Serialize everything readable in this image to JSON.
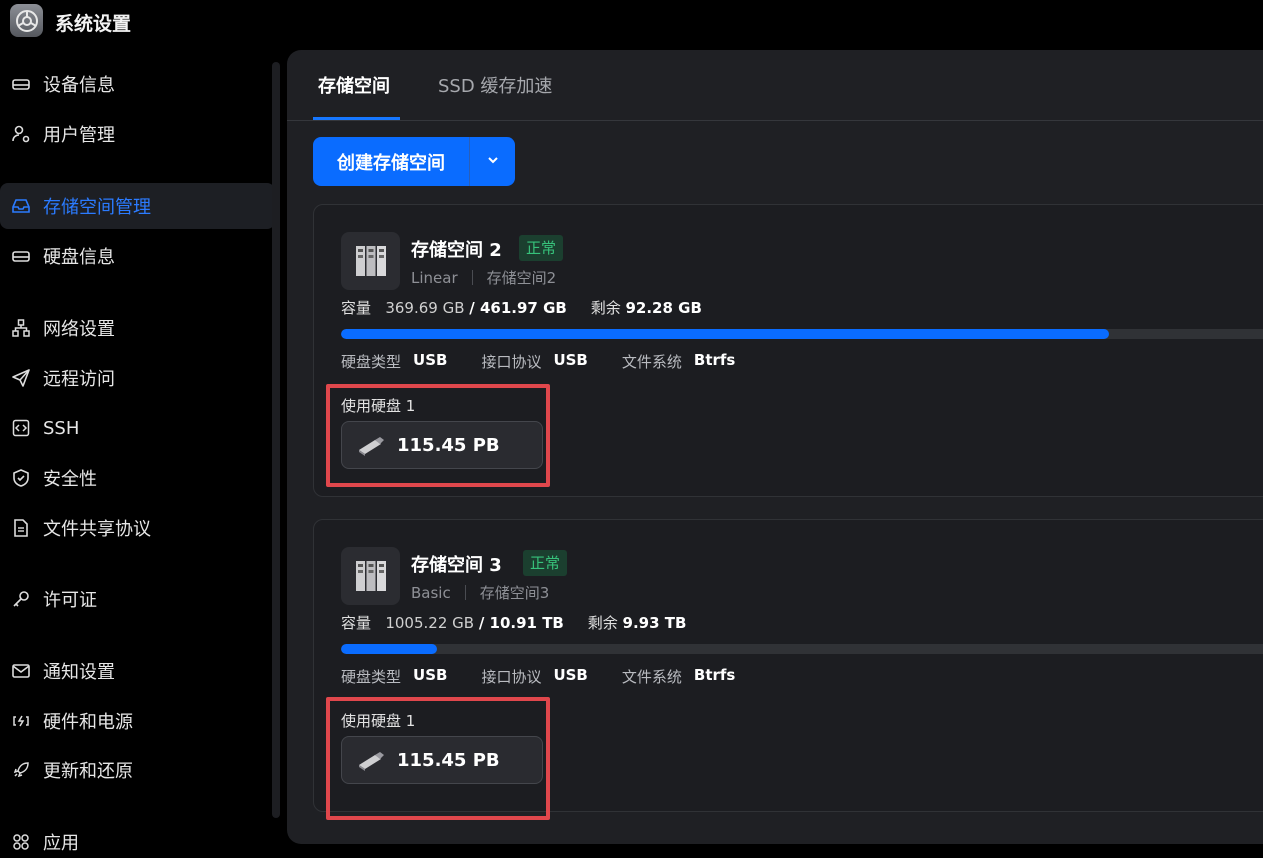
{
  "app": {
    "title": "系统设置"
  },
  "sidebar": {
    "items": [
      {
        "label": "设备信息",
        "icon": "drive-icon"
      },
      {
        "label": "用户管理",
        "icon": "user-gear-icon"
      },
      {
        "label": "存储空间管理",
        "icon": "inbox-icon",
        "active": true
      },
      {
        "label": "硬盘信息",
        "icon": "drive-icon"
      },
      {
        "label": "网络设置",
        "icon": "network-icon"
      },
      {
        "label": "远程访问",
        "icon": "paper-plane-icon"
      },
      {
        "label": "SSH",
        "icon": "code-icon"
      },
      {
        "label": "安全性",
        "icon": "shield-icon"
      },
      {
        "label": "文件共享协议",
        "icon": "document-icon"
      },
      {
        "label": "许可证",
        "icon": "key-icon"
      },
      {
        "label": "通知设置",
        "icon": "mail-icon"
      },
      {
        "label": "硬件和电源",
        "icon": "battery-icon"
      },
      {
        "label": "更新和还原",
        "icon": "rocket-icon"
      },
      {
        "label": "应用",
        "icon": "apps-grid-icon"
      }
    ]
  },
  "tabs": [
    {
      "label": "存储空间",
      "active": true
    },
    {
      "label": "SSD 缓存加速",
      "active": false
    }
  ],
  "toolbar": {
    "create_label": "创建存储空间"
  },
  "labels": {
    "capacity": "容量",
    "remaining": "剩余",
    "disk_type": "硬盘类型",
    "interface": "接口协议",
    "filesystem": "文件系统"
  },
  "pools": [
    {
      "name": "存储空间 2",
      "status": "正常",
      "raid": "Linear",
      "alias": "存储空间2",
      "used": "369.69 GB",
      "total": "/ 461.97 GB",
      "free": "92.28 GB",
      "usage_fraction": 0.8,
      "disk_type": "USB",
      "interface": "USB",
      "filesystem": "Btrfs",
      "disks_label": "使用硬盘 1",
      "disk_size": "115.45 PB"
    },
    {
      "name": "存储空间 3",
      "status": "正常",
      "raid": "Basic",
      "alias": "存储空间3",
      "used": "1005.22 GB",
      "total": "/ 10.91 TB",
      "free": "9.93 TB",
      "usage_fraction": 0.1,
      "disk_type": "USB",
      "interface": "USB",
      "filesystem": "Btrfs",
      "disks_label": "使用硬盘 1",
      "disk_size": "115.45 PB"
    }
  ],
  "colors": {
    "accent": "#0a6cff",
    "status_green": "#37c27b",
    "highlight": "#e0474c"
  }
}
